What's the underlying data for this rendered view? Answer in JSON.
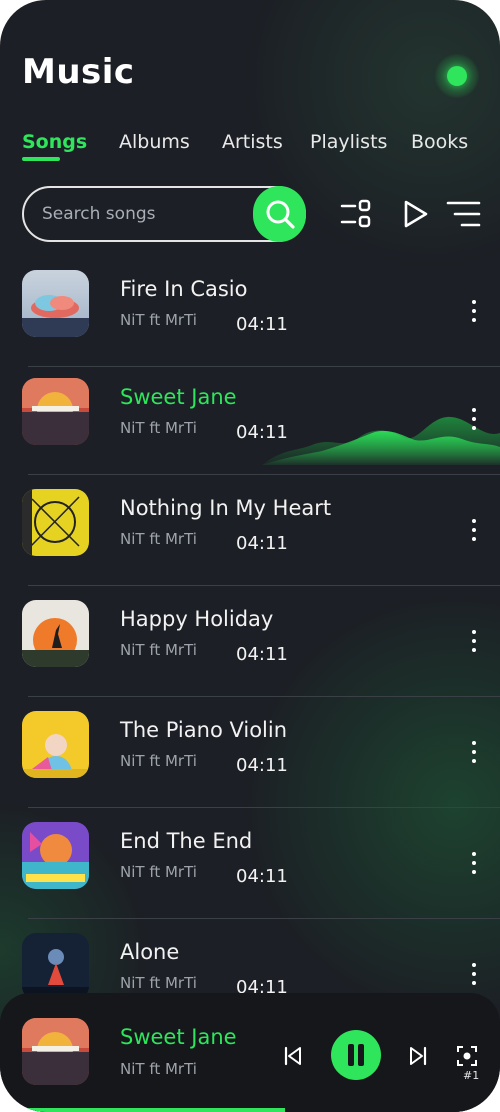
{
  "header": {
    "title": "Music"
  },
  "tabs": [
    {
      "label": "Songs",
      "active": true
    },
    {
      "label": "Albums",
      "active": false
    },
    {
      "label": "Artists",
      "active": false
    },
    {
      "label": "Playlists",
      "active": false
    },
    {
      "label": "Books",
      "active": false
    }
  ],
  "search": {
    "placeholder": "Search songs",
    "value": ""
  },
  "toolbar_icons": [
    "grid-toggle-icon",
    "play-icon",
    "sort-icon"
  ],
  "songs": [
    {
      "title": "Fire In Casio",
      "artist": "NiT ft MrTi",
      "duration": "04:11",
      "playing": false
    },
    {
      "title": "Sweet Jane",
      "artist": "NiT ft MrTi",
      "duration": "04:11",
      "playing": true
    },
    {
      "title": "Nothing In My Heart",
      "artist": "NiT ft MrTi",
      "duration": "04:11",
      "playing": false
    },
    {
      "title": "Happy Holiday",
      "artist": "NiT ft MrTi",
      "duration": "04:11",
      "playing": false
    },
    {
      "title": "The Piano Violin",
      "artist": "NiT ft MrTi",
      "duration": "04:11",
      "playing": false
    },
    {
      "title": "End  The End",
      "artist": "NiT ft MrTi",
      "duration": "04:11",
      "playing": false
    },
    {
      "title": "Alone",
      "artist": "NiT ft MrTi",
      "duration": "04:11",
      "playing": false
    }
  ],
  "now_playing": {
    "title": "Sweet Jane",
    "artist": "NiT ft MrTi",
    "device_label": "#1",
    "progress": 0.57
  },
  "colors": {
    "accent": "#2ee55b",
    "background": "#1c1f25",
    "player_bg": "#15171b"
  }
}
